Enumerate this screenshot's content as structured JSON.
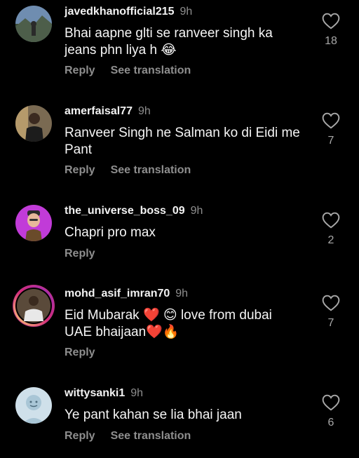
{
  "comments": [
    {
      "username": "javedkhanofficial215",
      "time": "9h",
      "text": "Bhai aapne glti se ranveer singh ka jeans phn liya h 😂",
      "reply_label": "Reply",
      "translate_label": "See translation",
      "likes": "18",
      "avatar_icon": "avatar-photo-landscape"
    },
    {
      "username": "amerfaisal77",
      "time": "9h",
      "text": "Ranveer Singh ne Salman ko di Eidi me Pant",
      "reply_label": "Reply",
      "translate_label": "See translation",
      "likes": "7",
      "avatar_icon": "avatar-photo-person"
    },
    {
      "username": "the_universe_boss_09",
      "time": "9h",
      "text": "Chapri pro max",
      "reply_label": "Reply",
      "translate_label": "",
      "likes": "2",
      "avatar_icon": "avatar-memoji"
    },
    {
      "username": "mohd_asif_imran70",
      "time": "9h",
      "text": "Eid Mubarak ❤️ 😊 love from dubai UAE bhaijaan❤️🔥",
      "reply_label": "Reply",
      "translate_label": "",
      "likes": "7",
      "avatar_icon": "avatar-photo-story-ring"
    },
    {
      "username": "wittysanki1",
      "time": "9h",
      "text": "Ye pant kahan se lia bhai jaan",
      "reply_label": "Reply",
      "translate_label": "See translation",
      "likes": "6",
      "avatar_icon": "avatar-illustration"
    }
  ],
  "colors": {
    "background": "#000000",
    "text": "#f5f5f5",
    "muted": "#8e8e8e",
    "story_ring": "#c13584"
  },
  "icons": {
    "like": "heart-outline-icon"
  }
}
